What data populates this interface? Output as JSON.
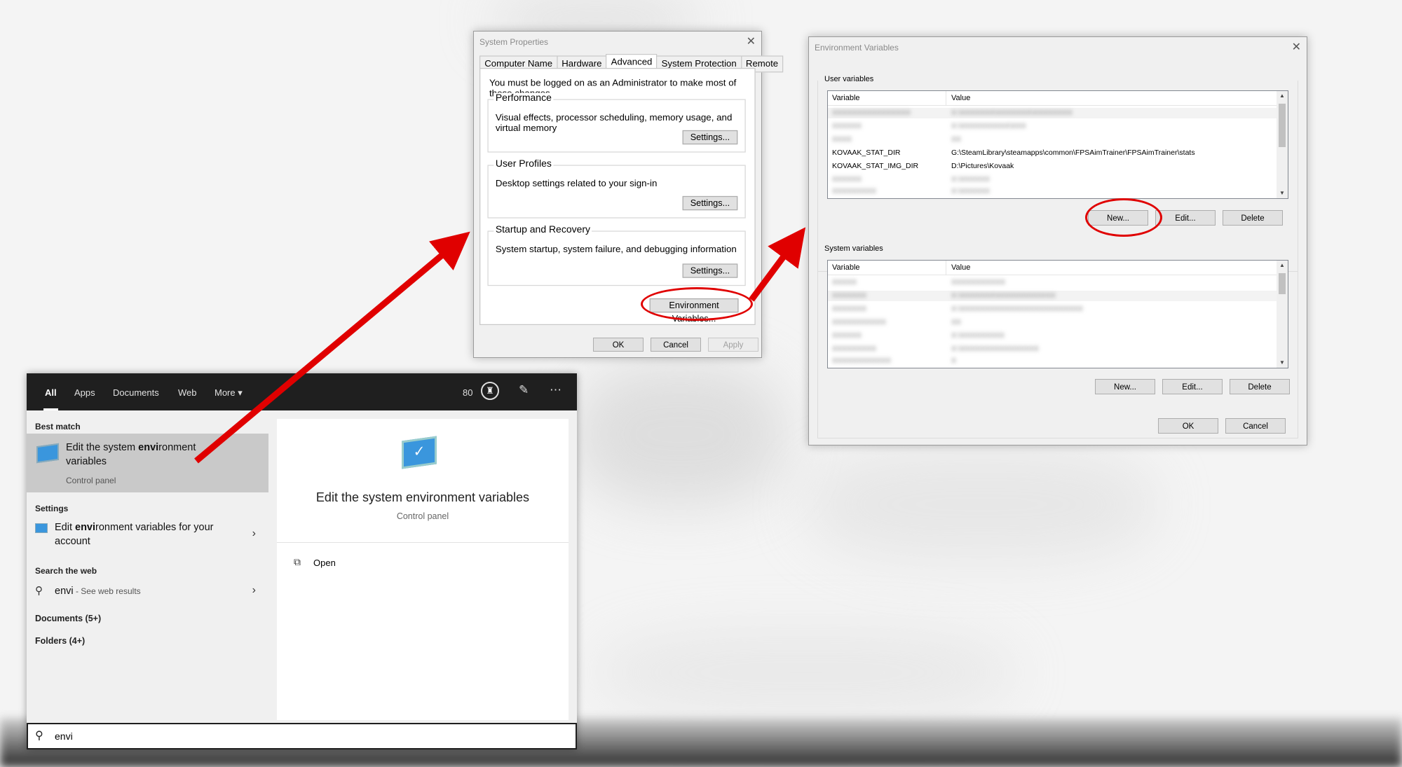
{
  "system_properties": {
    "title": "System Properties",
    "tabs": [
      "Computer Name",
      "Hardware",
      "Advanced",
      "System Protection",
      "Remote"
    ],
    "active_tab": "Advanced",
    "admin_note": "You must be logged on as an Administrator to make most of these changes.",
    "performance": {
      "label": "Performance",
      "desc": "Visual effects, processor scheduling, memory usage, and virtual memory",
      "button": "Settings..."
    },
    "user_profiles": {
      "label": "User Profiles",
      "desc": "Desktop settings related to your sign-in",
      "button": "Settings..."
    },
    "startup": {
      "label": "Startup and Recovery",
      "desc": "System startup, system failure, and debugging information",
      "button": "Settings..."
    },
    "env_button": "Environment Variables...",
    "ok": "OK",
    "cancel": "Cancel",
    "apply": "Apply"
  },
  "env_vars": {
    "title": "Environment Variables",
    "user_label": "User variables",
    "system_label": "System variables",
    "col_variable": "Variable",
    "col_value": "Value",
    "user_rows": [
      {
        "name": "KOVAAK_STAT_DIR",
        "value": "G:\\SteamLibrary\\steamapps\\common\\FPSAimTrainer\\FPSAimTrainer\\stats"
      },
      {
        "name": "KOVAAK_STAT_IMG_DIR",
        "value": "D:\\Pictures\\Kovaak"
      }
    ],
    "buttons": {
      "new": "New...",
      "edit": "Edit...",
      "delete": "Delete"
    },
    "ok": "OK",
    "cancel": "Cancel"
  },
  "search": {
    "tabs": [
      "All",
      "Apps",
      "Documents",
      "Web",
      "More"
    ],
    "points": "80",
    "best_match_label": "Best match",
    "best_match": {
      "title_pre": "Edit the system ",
      "title_bold": "envi",
      "title_post": "ronment variables",
      "sub": "Control panel"
    },
    "settings_label": "Settings",
    "settings_item": {
      "title_pre": "Edit ",
      "title_bold": "envi",
      "title_post": "ronment variables for your account"
    },
    "web_label": "Search the web",
    "web_item": {
      "query": "envi",
      "suffix": " - See web results"
    },
    "documents": "Documents (5+)",
    "folders": "Folders (4+)",
    "preview": {
      "title": "Edit the system environment variables",
      "sub": "Control panel",
      "open": "Open"
    },
    "query": "envi"
  },
  "colors": {
    "annotation": "#e00000",
    "accent": "#0078d7"
  }
}
